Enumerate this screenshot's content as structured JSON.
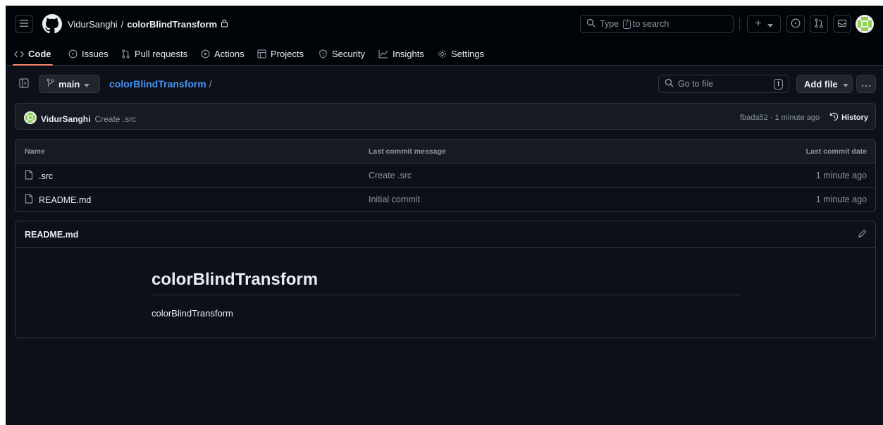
{
  "header": {
    "owner": "VidurSanghi",
    "separator": "/",
    "repo": "colorBlindTransform",
    "search_prefix": "Type",
    "search_key": "/",
    "search_suffix": "to search"
  },
  "tabs": [
    {
      "label": "Code",
      "icon": "code-icon"
    },
    {
      "label": "Issues",
      "icon": "issue-icon"
    },
    {
      "label": "Pull requests",
      "icon": "pull-request-icon"
    },
    {
      "label": "Actions",
      "icon": "play-icon"
    },
    {
      "label": "Projects",
      "icon": "table-icon"
    },
    {
      "label": "Security",
      "icon": "shield-icon"
    },
    {
      "label": "Insights",
      "icon": "graph-icon"
    },
    {
      "label": "Settings",
      "icon": "gear-icon"
    }
  ],
  "subbar": {
    "branch": "main",
    "breadcrumb": "colorBlindTransform",
    "breadcrumb_sep": "/",
    "goto_placeholder": "Go to file",
    "goto_key": "t",
    "add_file": "Add file"
  },
  "commit": {
    "author": "VidurSanghi",
    "message": "Create .src",
    "hash_time": "fbada52 · 1 minute ago",
    "history": "History"
  },
  "table": {
    "headers": {
      "name": "Name",
      "message": "Last commit message",
      "date": "Last commit date"
    },
    "rows": [
      {
        "name": ".src",
        "message": "Create .src",
        "date": "1 minute ago"
      },
      {
        "name": "README.md",
        "message": "Initial commit",
        "date": "1 minute ago"
      }
    ]
  },
  "readme": {
    "title": "README.md",
    "heading": "colorBlindTransform",
    "body": "colorBlindTransform"
  },
  "colors": {
    "background": "#0d1117",
    "header_bg": "#010409",
    "border": "#30363d",
    "link": "#4493f8",
    "active_tab": "#f78166",
    "avatar": "#8fd14f"
  }
}
